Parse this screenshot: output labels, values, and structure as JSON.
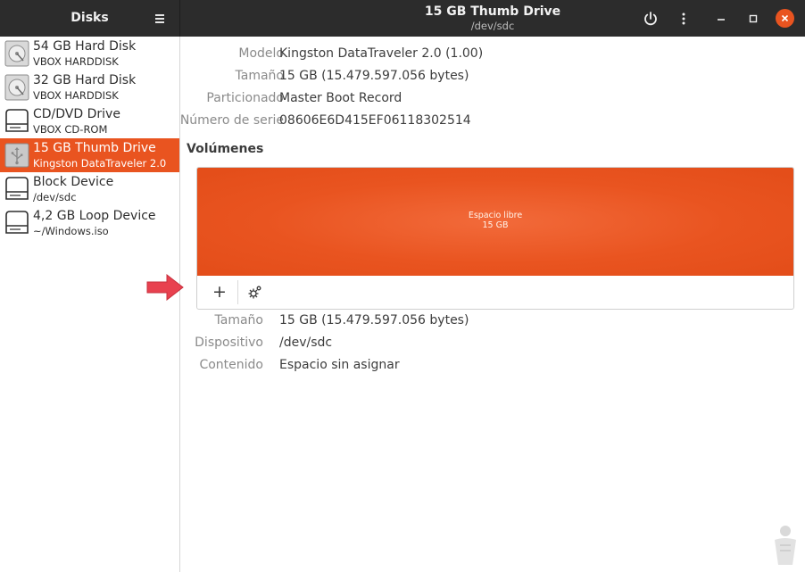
{
  "app": {
    "title": "Disks"
  },
  "window": {
    "title": "15 GB Thumb Drive",
    "subtitle": "/dev/sdc"
  },
  "sidebar": {
    "items": [
      {
        "name": "54 GB Hard Disk",
        "sub": "VBOX HARDDISK",
        "icon": "harddisk-icon",
        "selected": false
      },
      {
        "name": "32 GB Hard Disk",
        "sub": "VBOX HARDDISK",
        "icon": "harddisk-icon",
        "selected": false
      },
      {
        "name": "CD/DVD Drive",
        "sub": "VBOX CD-ROM",
        "icon": "optical-drive-icon",
        "selected": false
      },
      {
        "name": "15 GB Thumb Drive",
        "sub": "Kingston DataTraveler 2.0",
        "icon": "usb-drive-icon",
        "selected": true
      },
      {
        "name": "Block Device",
        "sub": "/dev/sdc",
        "icon": "drive-icon",
        "selected": false
      },
      {
        "name": "4,2 GB Loop Device",
        "sub": "~/Windows.iso",
        "icon": "drive-icon",
        "selected": false
      }
    ]
  },
  "drive_info": {
    "model_label": "Modelo",
    "model_value": "Kingston DataTraveler 2.0 (1.00)",
    "size_label": "Tamaño",
    "size_value": "15 GB (15.479.597.056 bytes)",
    "partitioning_label": "Particionado",
    "partitioning_value": "Master Boot Record",
    "serial_label": "Número de serie",
    "serial_value": "08606E6D415EF06118302514"
  },
  "volumes": {
    "heading": "Volúmenes",
    "bar_label": "Espacio libre",
    "bar_size": "15 GB",
    "add_symbol": "+"
  },
  "volume_info": {
    "size_label": "Tamaño",
    "size_value": "15 GB (15.479.597.056 bytes)",
    "device_label": "Dispositivo",
    "device_value": "/dev/sdc",
    "contents_label": "Contenido",
    "contents_value": "Espacio sin asignar"
  },
  "colors": {
    "accent": "#e95420",
    "titlebar": "#2c2c2c",
    "arrow": "#e8414f"
  }
}
